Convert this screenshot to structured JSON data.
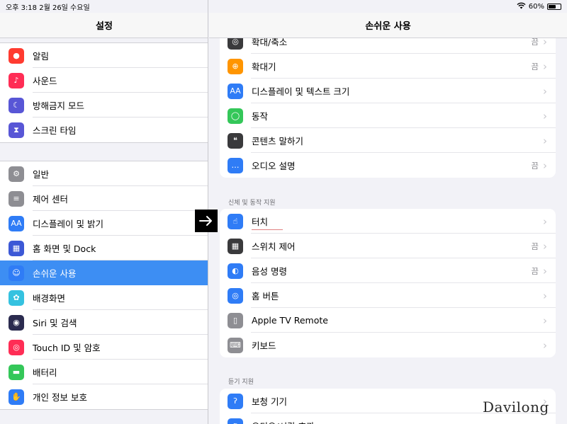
{
  "status_bar": {
    "time_date": "오후 3:18   2월 26일 수요일",
    "battery": "60%",
    "battery_level": 0.6
  },
  "sidebar": {
    "title": "설정",
    "group1": [
      {
        "label": "알림",
        "icon": "bell-icon",
        "color": "#ff3b30",
        "glyph": "●"
      },
      {
        "label": "사운드",
        "icon": "speaker-icon",
        "color": "#ff2d55",
        "glyph": "♪"
      },
      {
        "label": "방해금지 모드",
        "icon": "moon-icon",
        "color": "#5856d6",
        "glyph": "☾"
      },
      {
        "label": "스크린 타임",
        "icon": "hourglass-icon",
        "color": "#5856d6",
        "glyph": "⧗"
      }
    ],
    "group2": [
      {
        "label": "일반",
        "icon": "gear-icon",
        "color": "#8e8e93",
        "glyph": "⚙"
      },
      {
        "label": "제어 센터",
        "icon": "toggles-icon",
        "color": "#8e8e93",
        "glyph": "≡"
      },
      {
        "label": "디스플레이 및 밝기",
        "icon": "text-size-icon",
        "color": "#2f7cf6",
        "glyph": "AA"
      },
      {
        "label": "홈 화면 및 Dock",
        "icon": "home-grid-icon",
        "color": "#3c58d6",
        "glyph": "▦"
      },
      {
        "label": "손쉬운 사용",
        "icon": "accessibility-icon",
        "color": "#2f7cf6",
        "glyph": "☺"
      },
      {
        "label": "배경화면",
        "icon": "wallpaper-icon",
        "color": "#35c2e0",
        "glyph": "✿"
      },
      {
        "label": "Siri 및 검색",
        "icon": "siri-icon",
        "color": "#2b2b4f",
        "glyph": "◉"
      },
      {
        "label": "Touch ID 및 암호",
        "icon": "fingerprint-icon",
        "color": "#ff2d55",
        "glyph": "◎"
      },
      {
        "label": "배터리",
        "icon": "battery-icon",
        "color": "#34c759",
        "glyph": "▬"
      },
      {
        "label": "개인 정보 보호",
        "icon": "hand-icon",
        "color": "#2f7cf6",
        "glyph": "✋"
      }
    ]
  },
  "detail": {
    "title": "손쉬운 사용",
    "vision_rows": [
      {
        "label": "확대/축소",
        "value": "끔",
        "icon": "zoom-icon",
        "color": "#3a3a3c",
        "glyph": "◎"
      },
      {
        "label": "확대기",
        "value": "끔",
        "icon": "magnifier-icon",
        "color": "#ff9500",
        "glyph": "⊕"
      },
      {
        "label": "디스플레이 및 텍스트 크기",
        "value": "",
        "icon": "text-size-icon",
        "color": "#2f7cf6",
        "glyph": "AA"
      },
      {
        "label": "동작",
        "value": "",
        "icon": "motion-icon",
        "color": "#34c759",
        "glyph": "◯"
      },
      {
        "label": "콘텐츠 말하기",
        "value": "",
        "icon": "speech-bubble-icon",
        "color": "#3a3a3c",
        "glyph": "❝"
      },
      {
        "label": "오디오 설명",
        "value": "끔",
        "icon": "audio-description-icon",
        "color": "#2f7cf6",
        "glyph": "…"
      }
    ],
    "physical_header": "신체 및 동작 지원",
    "physical_rows": [
      {
        "label": "터치",
        "value": "",
        "icon": "touch-hand-icon",
        "color": "#2f7cf6",
        "glyph": "☝"
      },
      {
        "label": "스위치 제어",
        "value": "끔",
        "icon": "switch-grid-icon",
        "color": "#3a3a3c",
        "glyph": "▦"
      },
      {
        "label": "음성 명령",
        "value": "끔",
        "icon": "voice-control-icon",
        "color": "#2f7cf6",
        "glyph": "◐"
      },
      {
        "label": "홈 버튼",
        "value": "",
        "icon": "home-button-icon",
        "color": "#2f7cf6",
        "glyph": "◎"
      },
      {
        "label": "Apple TV Remote",
        "value": "",
        "icon": "remote-icon",
        "color": "#8e8e93",
        "glyph": "▯"
      },
      {
        "label": "키보드",
        "value": "",
        "icon": "keyboard-icon",
        "color": "#8e8e93",
        "glyph": "⌨"
      }
    ],
    "hearing_header": "듣기 지원",
    "hearing_rows": [
      {
        "label": "보청 기기",
        "value": "",
        "icon": "ear-icon",
        "color": "#2f7cf6",
        "glyph": "ʔ"
      },
      {
        "label": "오디오/시각 효과",
        "value": "",
        "icon": "audio-visual-icon",
        "color": "#2f7cf6",
        "glyph": "◐"
      }
    ],
    "chevron": "›"
  },
  "watermark": "Davilong"
}
